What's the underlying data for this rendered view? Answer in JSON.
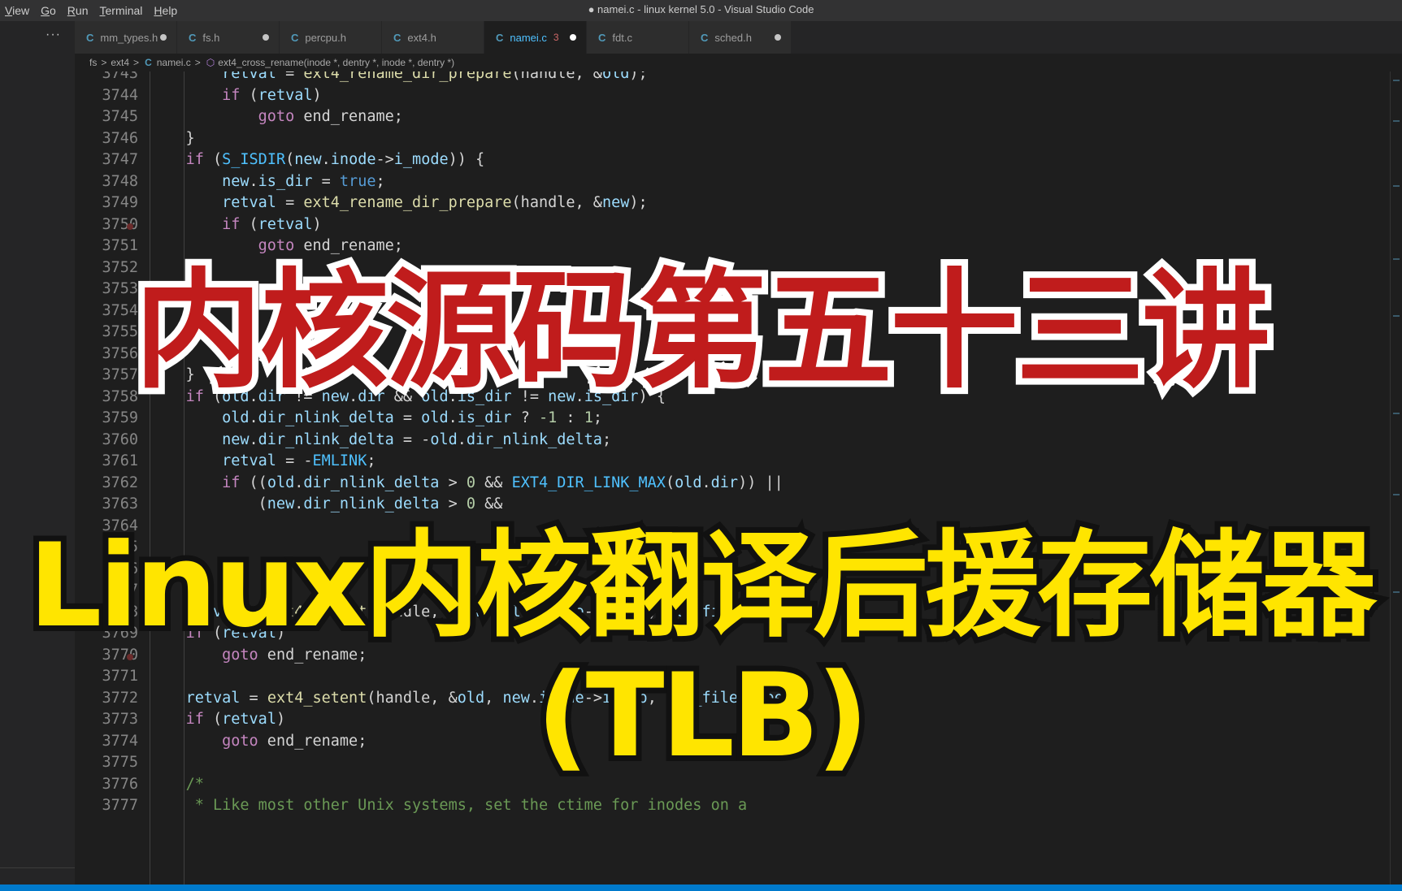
{
  "menu": [
    "View",
    "Go",
    "Run",
    "Terminal",
    "Help"
  ],
  "window_title": "● namei.c - linux kernel 5.0 - Visual Studio Code",
  "sidebar_more": "···",
  "tabs": [
    {
      "label": "mm_types.h",
      "dirty": true
    },
    {
      "label": "fs.h",
      "dirty": true
    },
    {
      "label": "percpu.h",
      "dirty": false
    },
    {
      "label": "ext4.h",
      "dirty": false
    },
    {
      "label": "namei.c",
      "badge": "3",
      "dirty": true,
      "active": true
    },
    {
      "label": "fdt.c",
      "dirty": false
    },
    {
      "label": "sched.h",
      "dirty": true
    }
  ],
  "tab_icon": "C",
  "breadcrumb": {
    "folder1": "fs",
    "folder2": "ext4",
    "file": "namei.c",
    "symbol": "ext4_cross_rename(inode *, dentry *, inode *, dentry *)",
    "sep": ">"
  },
  "code_lines": [
    {
      "n": "3743",
      "code": [
        [
          "        "
        ],
        [
          "var",
          "retval"
        ],
        [
          " = "
        ],
        [
          "fn",
          "ext4_rename_dir_prepare"
        ],
        [
          "(handle, &"
        ],
        [
          "var",
          "old"
        ],
        [
          ");"
        ]
      ]
    },
    {
      "n": "3744",
      "code": [
        [
          "        "
        ],
        [
          "cf",
          "if"
        ],
        [
          " ("
        ],
        [
          "var",
          "retval"
        ],
        [
          ")"
        ]
      ]
    },
    {
      "n": "3745",
      "code": [
        [
          "            "
        ],
        [
          "cf",
          "goto"
        ],
        [
          " end_rename;"
        ]
      ]
    },
    {
      "n": "3746",
      "code": [
        [
          "    }"
        ]
      ]
    },
    {
      "n": "3747",
      "code": [
        [
          "    "
        ],
        [
          "cf",
          "if"
        ],
        [
          " ("
        ],
        [
          "mac",
          "S_ISDIR"
        ],
        [
          "("
        ],
        [
          "var",
          "new"
        ],
        [
          "."
        ],
        [
          "var",
          "inode"
        ],
        [
          "->"
        ],
        [
          "var",
          "i_mode"
        ],
        [
          ")) {"
        ]
      ]
    },
    {
      "n": "3748",
      "code": [
        [
          "        "
        ],
        [
          "var",
          "new"
        ],
        [
          "."
        ],
        [
          "var",
          "is_dir"
        ],
        [
          " = "
        ],
        [
          "k2",
          "true"
        ],
        [
          ";"
        ]
      ]
    },
    {
      "n": "3749",
      "code": [
        [
          "        "
        ],
        [
          "var",
          "retval"
        ],
        [
          " = "
        ],
        [
          "fn",
          "ext4_rename_dir_prepare"
        ],
        [
          "(handle, &"
        ],
        [
          "var",
          "new"
        ],
        [
          ");"
        ]
      ]
    },
    {
      "n": "3750",
      "code": [
        [
          "        "
        ],
        [
          "cf",
          "if"
        ],
        [
          " ("
        ],
        [
          "var",
          "retval"
        ],
        [
          ")"
        ]
      ]
    },
    {
      "n": "3751",
      "code": [
        [
          "            "
        ],
        [
          "cf",
          "goto"
        ],
        [
          " end_rename;"
        ]
      ]
    },
    {
      "n": "3752",
      "code": [
        [
          "    }"
        ]
      ]
    },
    {
      "n": "3753",
      "code": [
        [
          ""
        ]
      ]
    },
    {
      "n": "3754",
      "code": [
        [
          ""
        ]
      ]
    },
    {
      "n": "3755",
      "code": [
        [
          ""
        ]
      ]
    },
    {
      "n": "3756",
      "code": [
        [
          ""
        ]
      ]
    },
    {
      "n": "3757",
      "code": [
        [
          "    }"
        ]
      ]
    },
    {
      "n": "3758",
      "code": [
        [
          "    "
        ],
        [
          "cf",
          "if"
        ],
        [
          " ("
        ],
        [
          "var",
          "old"
        ],
        [
          "."
        ],
        [
          "var",
          "dir"
        ],
        [
          " != "
        ],
        [
          "var",
          "new"
        ],
        [
          "."
        ],
        [
          "var",
          "dir"
        ],
        [
          " && "
        ],
        [
          "var",
          "old"
        ],
        [
          "."
        ],
        [
          "var",
          "is_dir"
        ],
        [
          " != "
        ],
        [
          "var",
          "new"
        ],
        [
          "."
        ],
        [
          "var",
          "is_dir"
        ],
        [
          ") {"
        ]
      ]
    },
    {
      "n": "3759",
      "code": [
        [
          "        "
        ],
        [
          "var",
          "old"
        ],
        [
          "."
        ],
        [
          "var",
          "dir_nlink_delta"
        ],
        [
          " = "
        ],
        [
          "var",
          "old"
        ],
        [
          "."
        ],
        [
          "var",
          "is_dir"
        ],
        [
          " ? "
        ],
        [
          "num",
          "-1"
        ],
        [
          " : "
        ],
        [
          "num",
          "1"
        ],
        [
          ";"
        ]
      ]
    },
    {
      "n": "3760",
      "code": [
        [
          "        "
        ],
        [
          "var",
          "new"
        ],
        [
          "."
        ],
        [
          "var",
          "dir_nlink_delta"
        ],
        [
          " = -"
        ],
        [
          "var",
          "old"
        ],
        [
          "."
        ],
        [
          "var",
          "dir_nlink_delta"
        ],
        [
          ";"
        ]
      ]
    },
    {
      "n": "3761",
      "code": [
        [
          "        "
        ],
        [
          "var",
          "retval"
        ],
        [
          " = -"
        ],
        [
          "mac",
          "EMLINK"
        ],
        [
          ";"
        ]
      ]
    },
    {
      "n": "3762",
      "code": [
        [
          "        "
        ],
        [
          "cf",
          "if"
        ],
        [
          " (("
        ],
        [
          "var",
          "old"
        ],
        [
          "."
        ],
        [
          "var",
          "dir_nlink_delta"
        ],
        [
          " > "
        ],
        [
          "num",
          "0"
        ],
        [
          " && "
        ],
        [
          "mac",
          "EXT4_DIR_LINK_MAX"
        ],
        [
          "("
        ],
        [
          "var",
          "old"
        ],
        [
          "."
        ],
        [
          "var",
          "dir"
        ],
        [
          ")) ||"
        ]
      ]
    },
    {
      "n": "3763",
      "code": [
        [
          "            ("
        ],
        [
          "var",
          "new"
        ],
        [
          "."
        ],
        [
          "var",
          "dir_nlink_delta"
        ],
        [
          " > "
        ],
        [
          "num",
          "0"
        ],
        [
          " &&"
        ]
      ]
    },
    {
      "n": "3764",
      "code": [
        [
          ""
        ]
      ]
    },
    {
      "n": "3765",
      "code": [
        [
          ""
        ]
      ]
    },
    {
      "n": "3766",
      "code": [
        [
          ""
        ]
      ]
    },
    {
      "n": "3767",
      "code": [
        [
          "    }"
        ]
      ]
    },
    {
      "n": "3768",
      "code": [
        [
          "    "
        ],
        [
          "var",
          "retval"
        ],
        [
          " = "
        ],
        [
          "fn",
          "ext4_setent"
        ],
        [
          "(handle, &"
        ],
        [
          "var",
          "new"
        ],
        [
          ", "
        ],
        [
          "var",
          "old"
        ],
        [
          "."
        ],
        [
          "var",
          "inode"
        ],
        [
          "->"
        ],
        [
          "var",
          "i_ino"
        ],
        [
          ", "
        ],
        [
          "var",
          "old_file_type"
        ],
        [
          ");"
        ]
      ]
    },
    {
      "n": "3769",
      "code": [
        [
          "    "
        ],
        [
          "cf",
          "if"
        ],
        [
          " ("
        ],
        [
          "var",
          "retval"
        ],
        [
          ")"
        ]
      ]
    },
    {
      "n": "3770",
      "code": [
        [
          "        "
        ],
        [
          "cf",
          "goto"
        ],
        [
          " end_rename;"
        ]
      ]
    },
    {
      "n": "3771",
      "code": [
        [
          ""
        ]
      ]
    },
    {
      "n": "3772",
      "code": [
        [
          "    "
        ],
        [
          "var",
          "retval"
        ],
        [
          " = "
        ],
        [
          "fn",
          "ext4_setent"
        ],
        [
          "(handle, &"
        ],
        [
          "var",
          "old"
        ],
        [
          ", "
        ],
        [
          "var",
          "new"
        ],
        [
          "."
        ],
        [
          "var",
          "inode"
        ],
        [
          "->"
        ],
        [
          "var",
          "i_ino"
        ],
        [
          ", "
        ],
        [
          "var",
          "new_file_type"
        ],
        [
          ");"
        ]
      ]
    },
    {
      "n": "3773",
      "code": [
        [
          "    "
        ],
        [
          "cf",
          "if"
        ],
        [
          " ("
        ],
        [
          "var",
          "retval"
        ],
        [
          ")"
        ]
      ]
    },
    {
      "n": "3774",
      "code": [
        [
          "        "
        ],
        [
          "cf",
          "goto"
        ],
        [
          " end_rename;"
        ]
      ]
    },
    {
      "n": "3775",
      "code": [
        [
          ""
        ]
      ]
    },
    {
      "n": "3776",
      "code": [
        [
          "    "
        ],
        [
          "cm",
          "/*"
        ]
      ]
    },
    {
      "n": "3777",
      "code": [
        [
          "    "
        ],
        [
          "cm",
          " * Like most other Unix systems, set the ctime for inodes on a"
        ]
      ]
    }
  ],
  "overlay": {
    "title": "内核源码第五十三讲",
    "subtitle": "Linux内核翻译后援存储器(TLB)",
    "title_color": "#c01c1c",
    "subtitle_color": "#ffe500"
  }
}
